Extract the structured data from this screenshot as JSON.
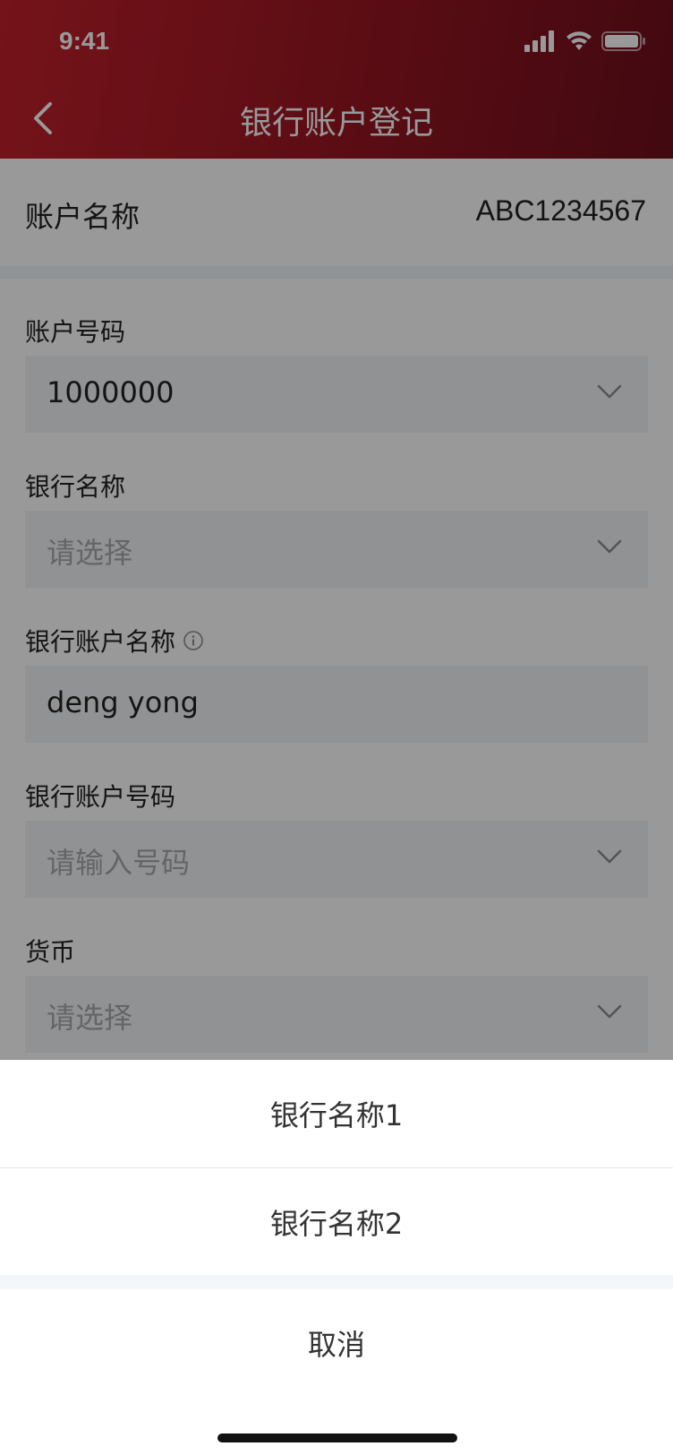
{
  "status_bar": {
    "time": "9:41"
  },
  "nav": {
    "title": "银行账户登记",
    "back_icon": "chevron-left-icon"
  },
  "account": {
    "label": "账户名称",
    "value": "ABC1234567"
  },
  "fields": {
    "account_number": {
      "label": "账户号码",
      "value": "1000000"
    },
    "bank_name": {
      "label": "银行名称",
      "placeholder": "请选择"
    },
    "bank_account_name": {
      "label": "银行账户名称",
      "value": "deng yong"
    },
    "bank_account_number": {
      "label": "银行账户号码",
      "placeholder": "请输入号码"
    },
    "currency": {
      "label": "货币",
      "placeholder": "请选择"
    }
  },
  "action_sheet": {
    "options": [
      "银行名称1",
      "银行名称2"
    ],
    "cancel": "取消"
  },
  "colors": {
    "header_start": "#c4202c",
    "header_end": "#6f0f1c",
    "field_bg": "#f2f3f5",
    "placeholder": "#a6a9ae"
  }
}
